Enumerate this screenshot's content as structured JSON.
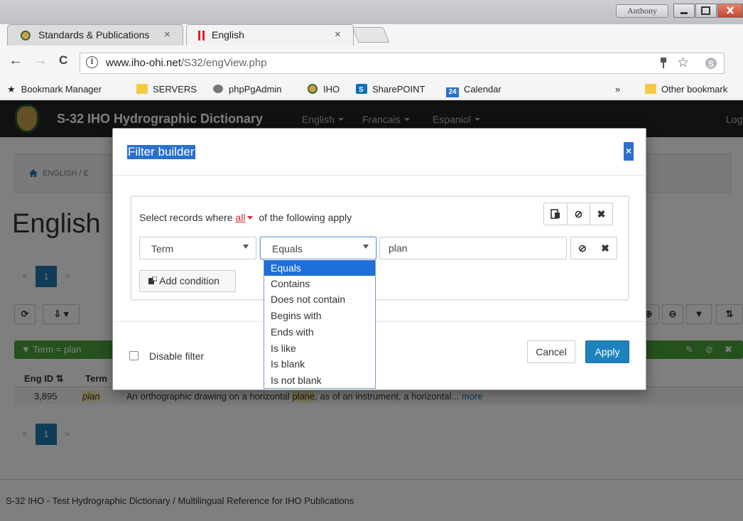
{
  "browser": {
    "tabs": [
      {
        "title": "Standards & Publications",
        "close": "×"
      },
      {
        "title": "English",
        "close": "×"
      }
    ],
    "user": "Anthony",
    "nav": {
      "back": "←",
      "forward": "→",
      "reload": "C"
    },
    "address": {
      "host": "www.iho-ohi.net",
      "path": "/S32/engView.php"
    },
    "bookmarks": [
      {
        "label": "Bookmark Manager"
      },
      {
        "label": "SERVERS"
      },
      {
        "label": "phpPgAdmin"
      },
      {
        "label": "IHO"
      },
      {
        "label": "SharePOINT"
      },
      {
        "label": "Calendar",
        "badge": "24"
      }
    ],
    "bookmarks_overflow": "»",
    "other_bookmarks": "Other bookmark"
  },
  "app": {
    "title": "S-32 IHO Hydrographic Dictionary",
    "menus": [
      "English",
      "Francais",
      "Espaniol"
    ],
    "login": "Log",
    "breadcrumb": "ENGLISH / E",
    "heading": "English",
    "pager": {
      "prev": "«",
      "page": "1",
      "next": "»"
    },
    "filter_bar": "Term = plan",
    "grid": {
      "headers": [
        "Eng ID",
        "Term"
      ],
      "row": {
        "id": "3,895",
        "term": "plan",
        "def_pre": "An orthographic drawing on a horizontal ",
        "def_hl": "plane",
        "def_post": ", as of an instrument, a horizontal...",
        "more": "more"
      }
    },
    "footer": "S-32 IHO - Test Hydrographic Dictionary / Multilingual Reference for IHO Publications"
  },
  "modal": {
    "title": "Filter builder",
    "close": "×",
    "lead_pre": "Select records where",
    "lead_all": "all",
    "lead_post": "of the following apply",
    "field": "Term",
    "operator": "Equals",
    "value": "plan",
    "add_condition": "Add condition",
    "disable_filter": "Disable filter",
    "cancel": "Cancel",
    "apply": "Apply",
    "operator_options": [
      "Equals",
      "Contains",
      "Does not contain",
      "Begins with",
      "Ends with",
      "Is like",
      "Is blank",
      "Is not blank"
    ]
  },
  "colors": {
    "accent": "#1e83bd",
    "filter_green": "#4aa23b",
    "selection": "#2b6fcf",
    "danger": "#d9292e"
  }
}
